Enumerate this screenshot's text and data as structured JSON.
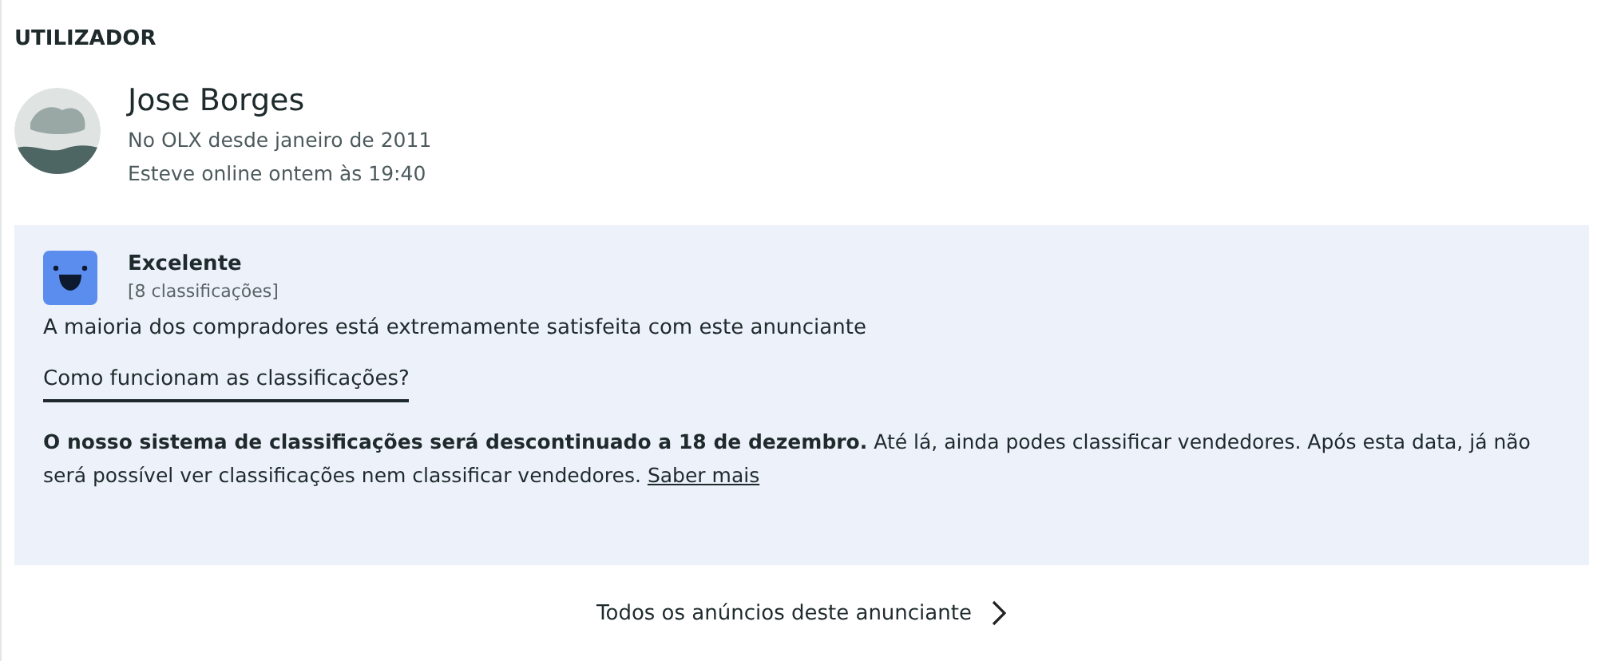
{
  "section_title": "UTILIZADOR",
  "user": {
    "name": "Jose Borges",
    "member_since": "No OLX desde janeiro de 2011",
    "last_online": "Esteve online ontem às 19:40"
  },
  "rating": {
    "label": "Excelente",
    "count": "[8 classificações]",
    "summary": "A maioria dos compradores está extremamente satisfeita com este anunciante",
    "help_link": "Como funcionam as classificações?",
    "notice": "**O nosso sistema de classificações será descontinuado a 18 de dezembro.** Até lá, ainda podes classificar vendedores. Após esta data, já não será possível ver classificações nem classificar vendedores.",
    "notice_link": "Saber mais"
  },
  "all_ads_link": "Todos os anúncios deste anunciante"
}
